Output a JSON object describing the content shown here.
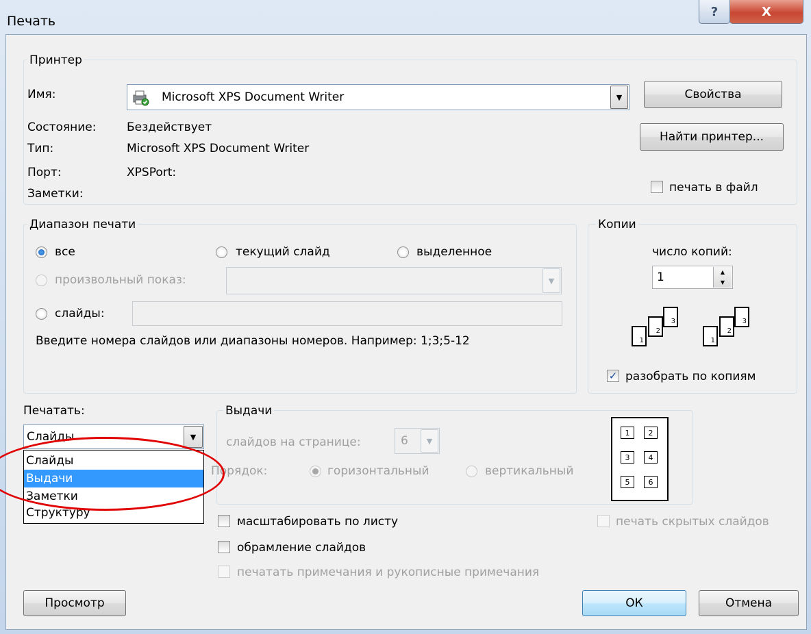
{
  "window": {
    "title": "Печать",
    "help": "?",
    "close": "X"
  },
  "printer": {
    "group_label": "Принтер",
    "name_label": "Имя:",
    "name_value": "Microsoft XPS Document Writer",
    "properties_button": "Свойства",
    "find_button": "Найти принтер...",
    "status_label": "Состояние:",
    "status_value": "Бездействует",
    "type_label": "Тип:",
    "type_value": "Microsoft XPS Document Writer",
    "port_label": "Порт:",
    "port_value": "XPSPort:",
    "notes_label": "Заметки:",
    "print_to_file": "печать в файл"
  },
  "range": {
    "group_label": "Диапазон печати",
    "all": "все",
    "current_slide": "текущий слайд",
    "selection": "выделенное",
    "custom_show": "произвольный показ:",
    "slides": "слайды:",
    "hint": "Введите номера слайдов или диапазоны номеров. Например: 1;3;5-12"
  },
  "copies": {
    "group_label": "Копии",
    "count_label": "число копий:",
    "count_value": "1",
    "collate": "разобрать по копиям",
    "collate_checked": "✓",
    "pages": [
      "1",
      "2",
      "3"
    ]
  },
  "print_what": {
    "label": "Печатать:",
    "selected": "Слайды",
    "options": [
      "Слайды",
      "Выдачи",
      "Заметки",
      "Структуру"
    ]
  },
  "handouts": {
    "group_label": "Выдачи",
    "per_page_label": "слайдов на странице:",
    "per_page_value": "6",
    "order_label": "Порядок:",
    "horizontal": "горизонтальный",
    "vertical": "вертикальный",
    "preview": [
      "1",
      "2",
      "3",
      "4",
      "5",
      "6"
    ]
  },
  "options": {
    "scale_to_fit": "масштабировать по листу",
    "frame_slides": "обрамление слайдов",
    "print_comments": "печатать примечания и рукописные примечания",
    "print_hidden": "печать скрытых слайдов"
  },
  "buttons": {
    "preview": "Просмотр",
    "ok": "ОК",
    "cancel": "Отмена"
  }
}
